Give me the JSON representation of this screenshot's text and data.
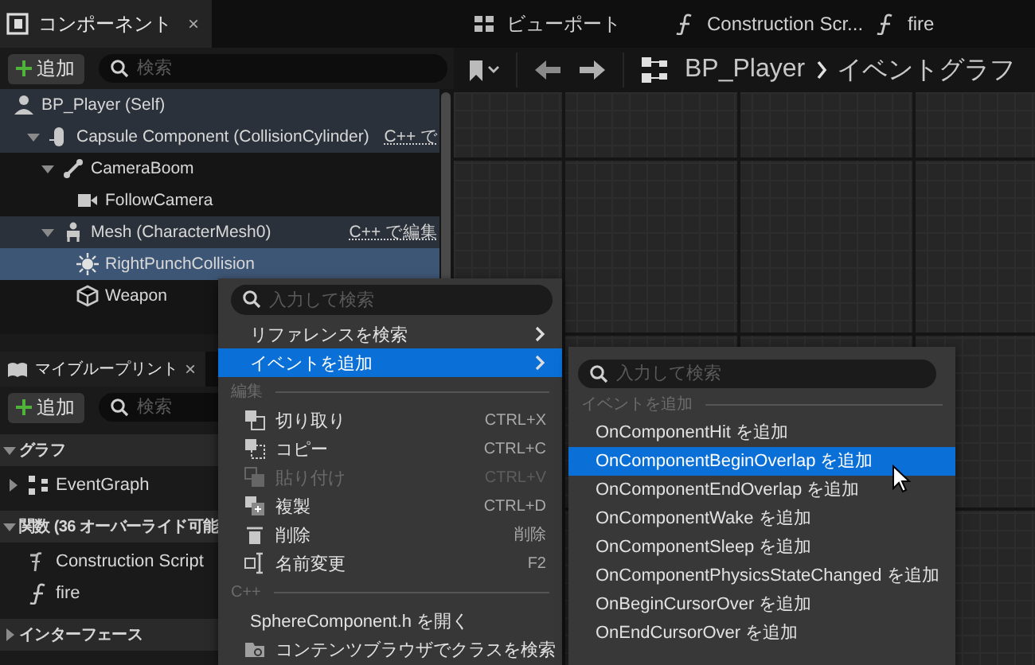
{
  "components_panel": {
    "tab": {
      "title": "コンポーネント",
      "close": "×",
      "selected": true
    },
    "add_button": "追加",
    "search": {
      "placeholder": "検索"
    },
    "tree": [
      {
        "label": "BP_Player (Self)",
        "kind": "actor",
        "inherited": true,
        "selected": false,
        "children": [
          {
            "label": "Capsule Component (CollisionCylinder)",
            "kind": "capsule",
            "badge": "C++ で",
            "inherited": true,
            "selected": false,
            "expanded": true,
            "children": [
              {
                "label": "CameraBoom",
                "kind": "spring-arm",
                "inherited": false,
                "selected": false,
                "expanded": true,
                "children": [
                  {
                    "label": "FollowCamera",
                    "kind": "camera",
                    "inherited": false,
                    "selected": false
                  }
                ]
              },
              {
                "label": "Mesh (CharacterMesh0)",
                "kind": "mesh",
                "badge": "C++ で編集",
                "inherited": true,
                "selected": false,
                "expanded": true,
                "children": [
                  {
                    "label": "RightPunchCollision",
                    "kind": "sphere",
                    "inherited": false,
                    "selected": true
                  },
                  {
                    "label": "Weapon",
                    "kind": "static-mesh",
                    "inherited": false,
                    "selected": false
                  }
                ]
              }
            ]
          }
        ]
      }
    ]
  },
  "blueprint_panel": {
    "tab": {
      "title": "マイブループリント",
      "close": "×"
    },
    "add_button": "追加",
    "search": {
      "placeholder": "検索"
    },
    "sections": [
      {
        "title": "グラフ",
        "expanded": true,
        "items": [
          {
            "label": "EventGraph",
            "kind": "graph",
            "expanded": false
          }
        ]
      },
      {
        "title": "関数 (36 オーバーライド可能",
        "expanded": true,
        "items": [
          {
            "label": "Construction Script",
            "kind": "override"
          },
          {
            "label": "fire",
            "kind": "function"
          }
        ]
      },
      {
        "title": "インターフェース",
        "expanded": false
      }
    ]
  },
  "editor_tabs": [
    {
      "label": "ビューポート",
      "kind": "viewport",
      "selected": false
    },
    {
      "label": "Construction Scr...",
      "kind": "function",
      "selected": false
    },
    {
      "label": "fire",
      "kind": "function",
      "selected": false
    }
  ],
  "breadcrumb": [
    "BP_Player",
    "イベントグラフ"
  ],
  "context_menu": {
    "search": {
      "placeholder": "入力して検索"
    },
    "items": [
      {
        "kind": "submenu",
        "label": "リファレンスを検索",
        "selected": false
      },
      {
        "kind": "submenu",
        "label": "イベントを追加",
        "selected": true
      },
      {
        "kind": "section",
        "label": "編集"
      },
      {
        "kind": "cut",
        "label": "切り取り",
        "shortcut": "CTRL+X",
        "disabled": false
      },
      {
        "kind": "copy",
        "label": "コピー",
        "shortcut": "CTRL+C",
        "disabled": false
      },
      {
        "kind": "paste",
        "label": "貼り付け",
        "shortcut": "CTRL+V",
        "disabled": true
      },
      {
        "kind": "duplicate",
        "label": "複製",
        "shortcut": "CTRL+D",
        "disabled": false
      },
      {
        "kind": "delete",
        "label": "削除",
        "shortcut": "削除",
        "disabled": false
      },
      {
        "kind": "rename",
        "label": "名前変更",
        "shortcut": "F2",
        "disabled": false
      },
      {
        "kind": "section",
        "label": "C++"
      },
      {
        "kind": "plain",
        "label": "SphereComponent.h を開く"
      },
      {
        "kind": "browse",
        "label": "コンテンツブラウザでクラスを検索"
      }
    ]
  },
  "event_submenu": {
    "search": {
      "placeholder": "入力して検索"
    },
    "section": "イベントを追加",
    "items": [
      {
        "label": "OnComponentHit を追加",
        "selected": false
      },
      {
        "label": "OnComponentBeginOverlap を追加",
        "selected": true
      },
      {
        "label": "OnComponentEndOverlap を追加",
        "selected": false
      },
      {
        "label": "OnComponentWake を追加",
        "selected": false
      },
      {
        "label": "OnComponentSleep を追加",
        "selected": false
      },
      {
        "label": "OnComponentPhysicsStateChanged を追加",
        "selected": false
      },
      {
        "label": "OnBeginCursorOver を追加",
        "selected": false
      },
      {
        "label": "OnEndCursorOver を追加",
        "selected": false
      }
    ]
  }
}
